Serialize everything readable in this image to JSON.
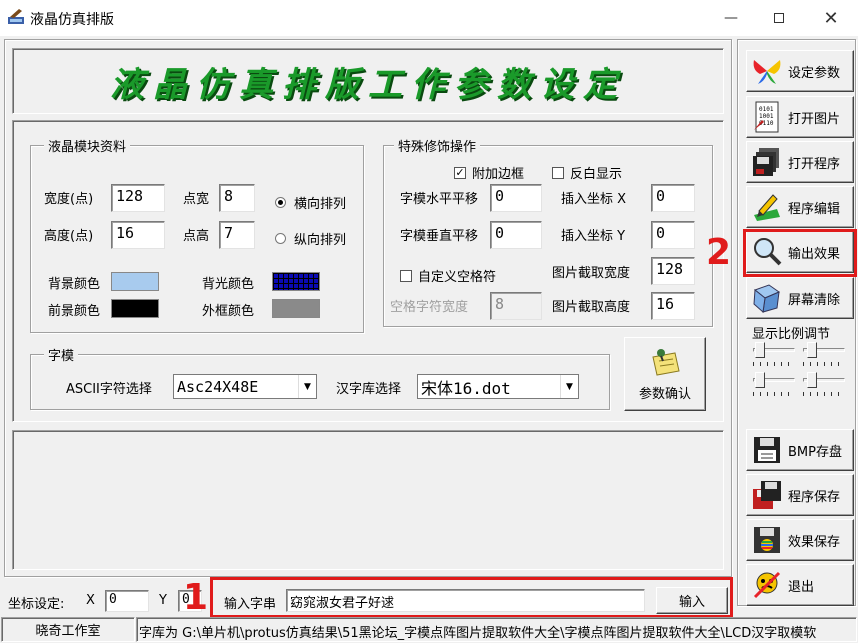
{
  "window": {
    "title": "液晶仿真排版",
    "icons": {
      "app": "lcd-app-icon",
      "minimize": "minimize-icon",
      "maximize": "maximize-icon",
      "close": "close-icon"
    }
  },
  "banner": {
    "title": "液晶仿真排版工作参数设定",
    "color": "#1a9a2a"
  },
  "lcd_module": {
    "group_title": "液晶模块资料",
    "width_label": "宽度(点)",
    "width_value": "128",
    "height_label": "高度(点)",
    "height_value": "16",
    "dot_width_label": "点宽",
    "dot_width_value": "8",
    "dot_height_label": "点高",
    "dot_height_value": "7",
    "horizontal_label": "横向排列",
    "vertical_label": "纵向排列",
    "orientation_selected": "horizontal",
    "bg_color_label": "背景颜色",
    "bg_color": "#a8cbee",
    "backlight_color_label": "背光颜色",
    "backlight_color": "#0a0ab4",
    "fg_color_label": "前景颜色",
    "fg_color": "#000000",
    "frame_color_label": "外框颜色",
    "frame_color": "#8a8a8a"
  },
  "special": {
    "group_title": "特殊修饰操作",
    "add_border_label": "附加边框",
    "add_border_checked": true,
    "invert_label": "反白显示",
    "invert_checked": false,
    "hshift_label": "字模水平平移",
    "hshift_value": "0",
    "vshift_label": "字模垂直平移",
    "vshift_value": "0",
    "insert_x_label": "插入坐标 X",
    "insert_x_value": "0",
    "insert_y_label": "插入坐标 Y",
    "insert_y_value": "0",
    "custom_space_label": "自定义空格符",
    "custom_space_checked": false,
    "space_width_label": "空格字符宽度",
    "space_width_value": "8",
    "crop_width_label": "图片截取宽度",
    "crop_width_value": "128",
    "crop_height_label": "图片截取高度",
    "crop_height_value": "16"
  },
  "font": {
    "group_title": "字模",
    "ascii_label": "ASCII字符选择",
    "ascii_value": "Asc24X48E",
    "hanzi_label": "汉字库选择",
    "hanzi_value": "宋体16.dot"
  },
  "confirm_button": {
    "label": "参数确认",
    "icon": "pushpin-note-icon"
  },
  "sidebar": {
    "buttons": [
      {
        "label": "设定参数",
        "icon": "butterfly-icon"
      },
      {
        "label": "打开图片",
        "icon": "binary-file-icon"
      },
      {
        "label": "打开程序",
        "icon": "floppy-stack-icon"
      },
      {
        "label": "程序编辑",
        "icon": "pencil-edit-icon"
      },
      {
        "label": "输出效果",
        "icon": "magnifier-icon"
      },
      {
        "label": "屏幕清除",
        "icon": "eraser-icon"
      },
      {
        "label": "BMP存盘",
        "icon": "bmp-disk-icon"
      },
      {
        "label": "程序保存",
        "icon": "disk-save-icon"
      },
      {
        "label": "效果保存",
        "icon": "apple-disk-icon"
      },
      {
        "label": "退出",
        "icon": "exit-icon"
      }
    ],
    "scale_label": "显示比例调节"
  },
  "annotations": {
    "marker_1": "1",
    "marker_2": "2",
    "color": "#e01b1b"
  },
  "bottom": {
    "coord_label": "坐标设定:",
    "x_label": "X",
    "x_value": "0",
    "y_label": "Y",
    "y_value": "0",
    "input_label": "输入字串",
    "input_value": "窈窕淑女君子好逑",
    "input_button": "输入"
  },
  "status": {
    "left": "晓奇工作室",
    "right": "字库为 G:\\单片机\\protus仿真结果\\51黑论坛_字模点阵图片提取软件大全\\字模点阵图片提取软件大全\\LCD汉字取模软"
  }
}
